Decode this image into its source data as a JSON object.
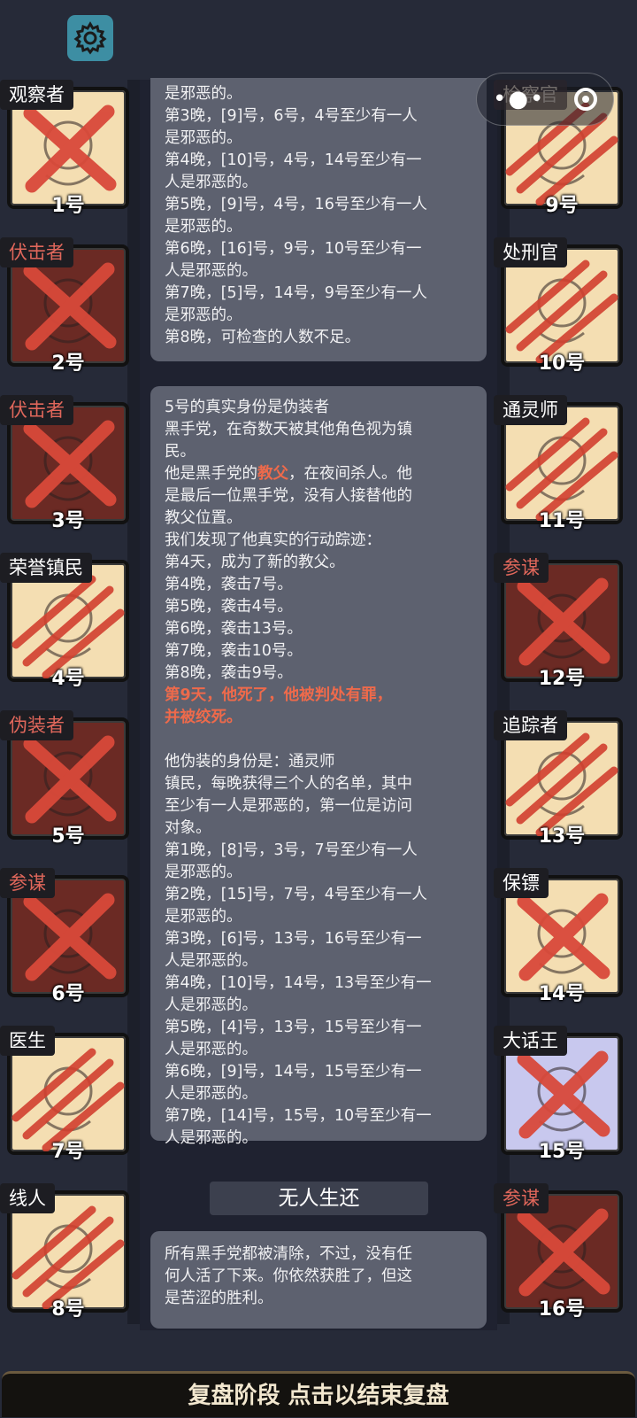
{
  "header": {
    "settings_icon": "gear-icon",
    "capsule_icons": [
      "more-dots-icon",
      "close-ring-icon"
    ]
  },
  "cards_left": [
    {
      "role": "观察者",
      "num": "1号",
      "face": "light",
      "mark": "x",
      "tag": "dark"
    },
    {
      "role": "伏击者",
      "num": "2号",
      "face": "dark",
      "mark": "x",
      "tag": "red"
    },
    {
      "role": "伏击者",
      "num": "3号",
      "face": "dark",
      "mark": "x",
      "tag": "red"
    },
    {
      "role": "荣誉镇民",
      "num": "4号",
      "face": "light",
      "mark": "claw",
      "tag": "dark"
    },
    {
      "role": "伪装者",
      "num": "5号",
      "face": "dark",
      "mark": "x",
      "tag": "red"
    },
    {
      "role": "参谋",
      "num": "6号",
      "face": "dark",
      "mark": "x",
      "tag": "red"
    },
    {
      "role": "医生",
      "num": "7号",
      "face": "light",
      "mark": "claw",
      "tag": "dark"
    },
    {
      "role": "线人",
      "num": "8号",
      "face": "light",
      "mark": "claw",
      "tag": "dark"
    }
  ],
  "cards_right": [
    {
      "role": "检察官",
      "num": "9号",
      "face": "light",
      "mark": "claw",
      "tag": "half"
    },
    {
      "role": "处刑官",
      "num": "10号",
      "face": "light",
      "mark": "claw",
      "tag": "dark"
    },
    {
      "role": "通灵师",
      "num": "11号",
      "face": "light",
      "mark": "claw",
      "tag": "dark"
    },
    {
      "role": "参谋",
      "num": "12号",
      "face": "dark",
      "mark": "x",
      "tag": "red"
    },
    {
      "role": "追踪者",
      "num": "13号",
      "face": "light",
      "mark": "claw",
      "tag": "dark"
    },
    {
      "role": "保镖",
      "num": "14号",
      "face": "light",
      "mark": "x",
      "tag": "dark"
    },
    {
      "role": "大话王",
      "num": "15号",
      "face": "blue",
      "mark": "x",
      "tag": "dark"
    },
    {
      "role": "参谋",
      "num": "16号",
      "face": "dark",
      "mark": "x",
      "tag": "red"
    }
  ],
  "log1": {
    "lines": [
      "是邪恶的。",
      "第3晚，[9]号，6号，4号至少有一人\n是邪恶的。",
      "第4晚，[10]号，4号，14号至少有一\n人是邪恶的。",
      "第5晚，[9]号，4号，16号至少有一人\n是邪恶的。",
      "第6晚，[16]号，9号，10号至少有一\n人是邪恶的。",
      "第7晚，[5]号，14号，9号至少有一人\n是邪恶的。",
      "第8晚，可检查的人数不足。"
    ]
  },
  "log2": {
    "title": "5号的真实身份是伪装者",
    "desc": "黑手党，在奇数天被其他角色视为镇\n民。",
    "godfather_pre": "他是黑手党的",
    "godfather_word": "教父",
    "godfather_post": "，在夜间杀人。他\n是最后一位黑手党，没有人接替他的\n教父位置。",
    "track_title": "我们发现了他真实的行动踪迹：",
    "track": [
      "第4天，成为了新的教父。",
      "第4晚，袭击7号。",
      "第5晚，袭击4号。",
      "第6晚，袭击13号。",
      "第7晚，袭击10号。",
      "第8晚，袭击9号。"
    ],
    "death": "第9天，他死了，他被判处有罪，\n并被绞死。",
    "disguise": "他伪装的身份是：通灵师",
    "disguise_desc": "镇民，每晚获得三个人的名单，其中\n至少有一人是邪恶的，第一位是访问\n对象。",
    "nights": [
      "第1晚，[8]号，3号，7号至少有一人\n是邪恶的。",
      "第2晚，[15]号，7号，4号至少有一人\n是邪恶的。",
      "第3晚，[6]号，13号，16号至少有一\n人是邪恶的。",
      "第4晚，[10]号，14号，13号至少有一\n人是邪恶的。",
      "第5晚，[4]号，13号，15号至少有一\n人是邪恶的。",
      "第6晚，[9]号，14号，15号至少有一\n人是邪恶的。",
      "第7晚，[14]号，15号，10号至少有一\n人是邪恶的。"
    ]
  },
  "banner": "无人生还",
  "log3": "所有黑手党都被清除，不过，没有任\n何人活了下来。你依然获胜了，但这\n是苦涩的胜利。",
  "bottom_bar": "复盘阶段 点击以结束复盘",
  "colors": {
    "accent": "#ee6a4b",
    "mark": "#d9493a",
    "gear_bg": "#3d8ea3"
  }
}
